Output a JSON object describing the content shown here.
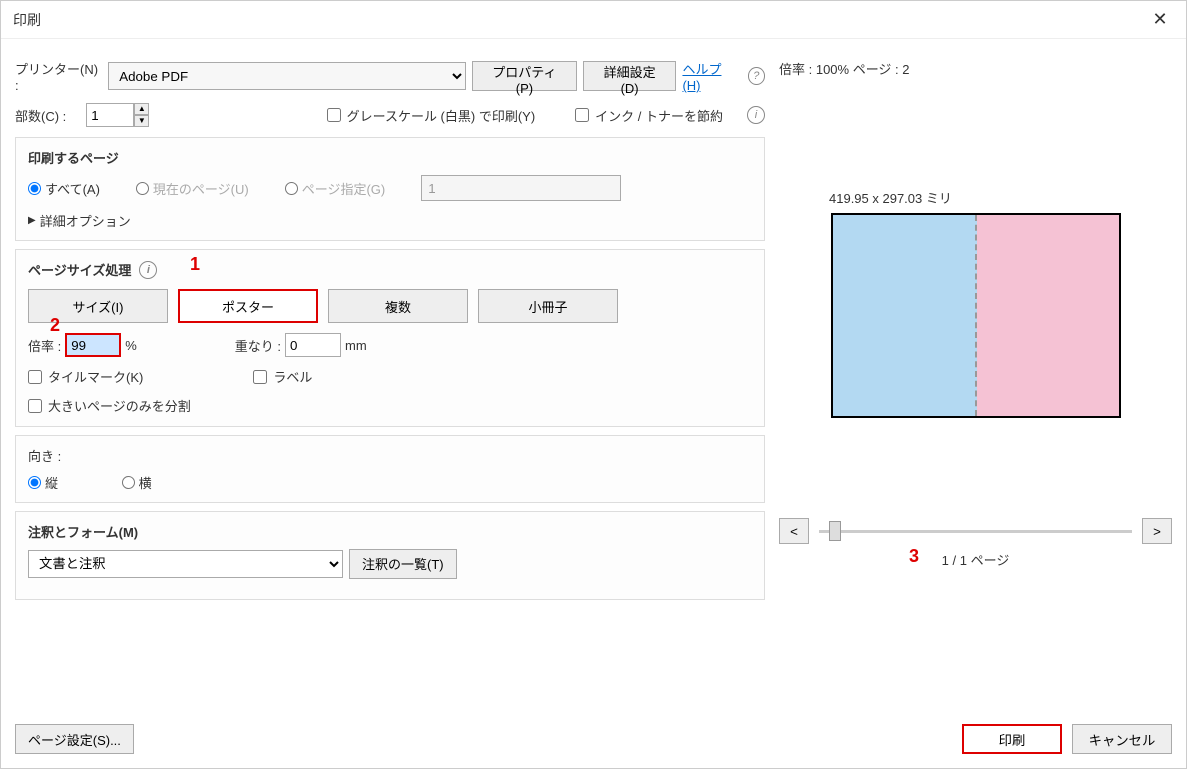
{
  "window": {
    "title": "印刷"
  },
  "printer": {
    "label": "プリンター(N) :",
    "value": "Adobe PDF",
    "properties_btn": "プロパティ(P)",
    "advanced_btn": "詳細設定(D)"
  },
  "help": {
    "link": "ヘルプ(H)"
  },
  "copies": {
    "label": "部数(C) :",
    "value": "1"
  },
  "options": {
    "grayscale": "グレースケール (白黒) で印刷(Y)",
    "save_ink": "インク / トナーを節約"
  },
  "pages": {
    "title": "印刷するページ",
    "all": "すべて(A)",
    "current": "現在のページ(U)",
    "range": "ページ指定(G)",
    "range_value": "1",
    "more": "詳細オプション"
  },
  "sizing": {
    "title": "ページサイズ処理",
    "size_btn": "サイズ(I)",
    "poster_btn": "ポスター",
    "multi_btn": "複数",
    "booklet_btn": "小冊子",
    "scale_label": "倍率 :",
    "scale_value": "99",
    "scale_unit": "%",
    "overlap_label": "重なり :",
    "overlap_value": "0",
    "overlap_unit": "mm",
    "tile_marks": "タイルマーク(K)",
    "labels": "ラベル",
    "split_large": "大きいページのみを分割"
  },
  "orientation": {
    "title": "向き :",
    "portrait": "縦",
    "landscape": "横"
  },
  "comments": {
    "title": "注釈とフォーム(M)",
    "value": "文書と注釈",
    "summary_btn": "注釈の一覧(T)"
  },
  "preview": {
    "scale_info": "倍率 : 100% ページ : 2",
    "dimensions": "419.95 x 297.03 ミリ",
    "prev": "<",
    "next": ">",
    "page_info": "1 / 1 ページ"
  },
  "bottom": {
    "page_setup": "ページ設定(S)...",
    "print": "印刷",
    "cancel": "キャンセル"
  },
  "annotations": {
    "n1": "1",
    "n2": "2",
    "n3": "3"
  }
}
